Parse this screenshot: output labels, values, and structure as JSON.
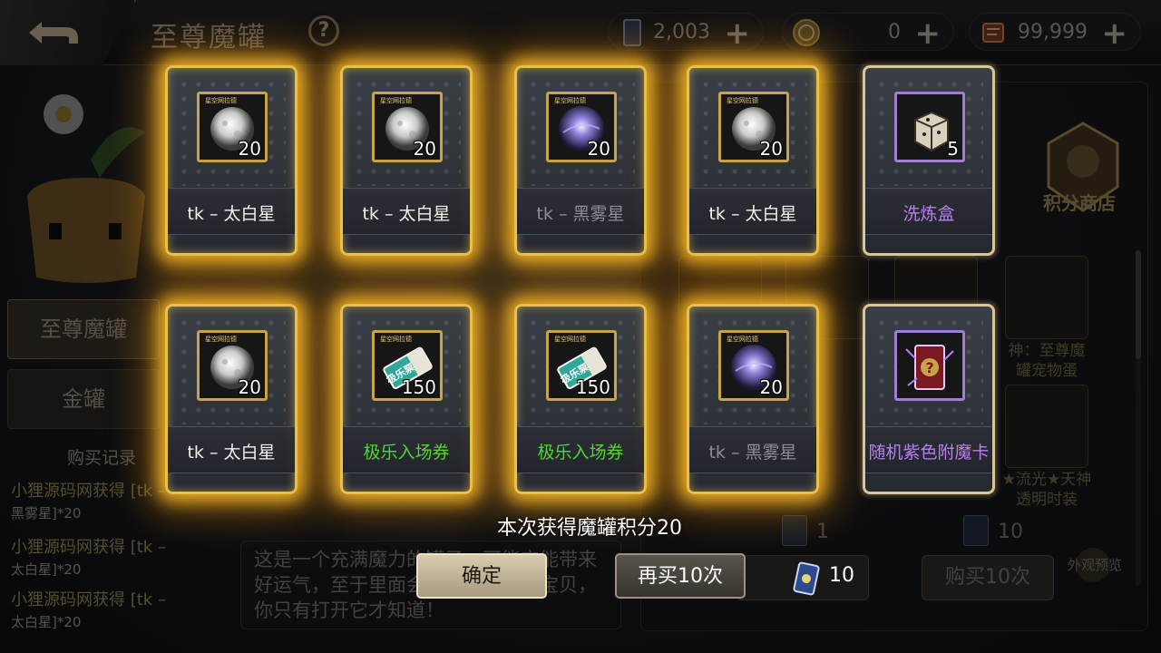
{
  "header": {
    "title": "至尊魔罐",
    "help_glyph": "?",
    "currencies": [
      {
        "icon": "ticket-icon",
        "value": "2,003"
      },
      {
        "icon": "gold-coin-icon",
        "value": "0"
      },
      {
        "icon": "scroll-icon",
        "value": "99,999"
      }
    ],
    "plus_glyph": "+"
  },
  "sidebar": {
    "tabs": [
      "至尊魔罐",
      "金罐"
    ],
    "log_title": "购买记录",
    "log_entries": [
      {
        "text": "小狸源码网获得 [tk –",
        "sub": "黑雾星]*20"
      },
      {
        "text": "小狸源码网获得 [tk –",
        "sub": "太白星]*20"
      },
      {
        "text": "小狸源码网获得 [tk –",
        "sub": "太白星]*20"
      }
    ]
  },
  "description": "这是一个充满魔力的罐子，可能它能带来好运气，至于里面会出现什么样的宝贝，你只有打开它才知道！",
  "shop_panel": {
    "points_shop": "积分商店",
    "item_label_1": "神：至尊魔罐宠物蛋",
    "item_label_2": "★流光★天神透明时装",
    "count_1": "1",
    "count_2": "10",
    "buy_label": "购买10次",
    "preview_label": "外观预览"
  },
  "rewards": [
    {
      "name": "tk – 太白星",
      "qty": "20",
      "art": "moon-orb",
      "tag": "星空网拉德",
      "color": "white",
      "glow": true
    },
    {
      "name": "tk – 太白星",
      "qty": "20",
      "art": "moon-orb",
      "tag": "星空网拉德",
      "color": "white",
      "glow": true
    },
    {
      "name": "tk – 黑雾星",
      "qty": "20",
      "art": "nebula-orb",
      "tag": "星空网拉德",
      "color": "gray",
      "glow": true
    },
    {
      "name": "tk – 太白星",
      "qty": "20",
      "art": "moon-orb",
      "tag": "星空网拉德",
      "color": "white",
      "glow": true
    },
    {
      "name": "洗炼盒",
      "qty": "5",
      "art": "refine-box",
      "tag": "",
      "color": "purple",
      "glow": false
    },
    {
      "name": "tk – 太白星",
      "qty": "20",
      "art": "moon-orb",
      "tag": "星空网拉德",
      "color": "white",
      "glow": true
    },
    {
      "name": "极乐入场券",
      "qty": "150",
      "art": "entry-ticket",
      "tag": "星空网拉德",
      "color": "green",
      "glow": true
    },
    {
      "name": "极乐入场券",
      "qty": "150",
      "art": "entry-ticket",
      "tag": "星空网拉德",
      "color": "green",
      "glow": true
    },
    {
      "name": "tk – 黑雾星",
      "qty": "20",
      "art": "nebula-orb",
      "tag": "星空网拉德",
      "color": "gray",
      "glow": true
    },
    {
      "name": "随机紫色附魔卡",
      "qty": "",
      "art": "mystery-card",
      "tag": "",
      "color": "purple",
      "glow": false
    }
  ],
  "result": {
    "message": "本次获得魔罐积分20",
    "confirm_label": "确定",
    "rebuy_label": "再买10次",
    "cost": "10"
  },
  "colors": {
    "glow_gold": "#e8c14a",
    "name_green": "#55d236",
    "name_purple": "#b87ef0",
    "name_gray": "#8c8e93"
  }
}
